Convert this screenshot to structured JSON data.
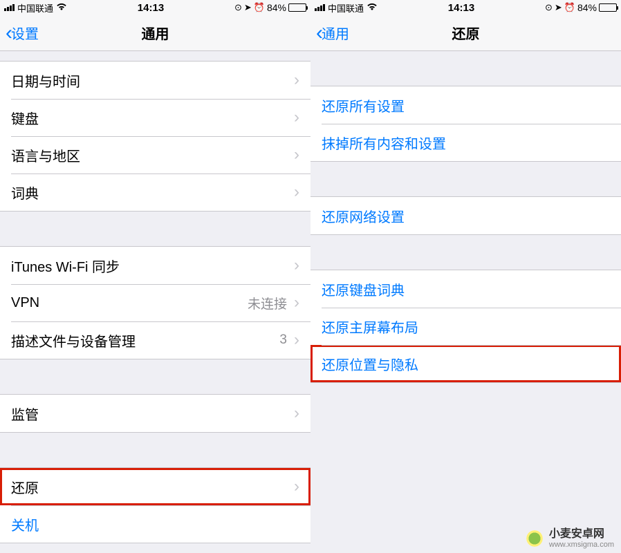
{
  "status": {
    "carrier": "中国联通",
    "time": "14:13",
    "battery": "84%"
  },
  "left": {
    "back": "设置",
    "title": "通用",
    "rows": {
      "dateTime": "日期与时间",
      "keyboard": "键盘",
      "langRegion": "语言与地区",
      "dict": "词典",
      "itunesWifi": "iTunes Wi-Fi 同步",
      "vpn": "VPN",
      "vpnDetail": "未连接",
      "profiles": "描述文件与设备管理",
      "profilesDetail": "3",
      "supervision": "监管",
      "reset": "还原",
      "shutdown": "关机"
    }
  },
  "right": {
    "back": "通用",
    "title": "还原",
    "rows": {
      "resetAll": "还原所有设置",
      "eraseAll": "抹掉所有内容和设置",
      "resetNetwork": "还原网络设置",
      "resetKeyboard": "还原键盘词典",
      "resetHome": "还原主屏幕布局",
      "resetLocation": "还原位置与隐私"
    }
  },
  "watermark": {
    "name": "小麦安卓网",
    "url": "www.xmsigma.com"
  }
}
